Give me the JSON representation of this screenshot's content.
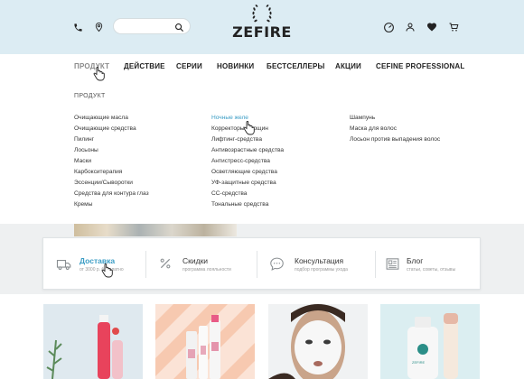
{
  "brand": {
    "name": "ZEFIRE"
  },
  "header": {
    "search": {
      "placeholder": ""
    }
  },
  "nav": {
    "items": [
      {
        "label": "ПРОДУКТ"
      },
      {
        "label": "ДЕЙСТВИЕ"
      },
      {
        "label": "СЕРИИ"
      },
      {
        "label": "НОВИНКИ"
      },
      {
        "label": "БЕСТСЕЛЛЕРЫ"
      },
      {
        "label": "АКЦИИ"
      },
      {
        "label": "CEFINE PROFESSIONAL"
      }
    ]
  },
  "dropdown": {
    "title": "ПРОДУКТ",
    "col1": [
      "Очищающие масла",
      "Очищающие средства",
      "Пилинг",
      "Лосьоны",
      "Маски",
      "Карбокситерапия",
      "Эссенции/Сыворотки",
      "Средства для контура глаз",
      "Кремы"
    ],
    "col2": [
      "Ночные желе",
      "Корректоры морщин",
      "Лифтинг-средства",
      "Антивозрастные средства",
      "Антистресс-средства",
      "Осветляющие средства",
      "УФ-защитные средства",
      "CC-средства",
      "Тональные средства"
    ],
    "col3": [
      "Шампунь",
      "Маска для волос",
      "Лосьон против выпадения волос"
    ]
  },
  "info": [
    {
      "title": "Доставка",
      "subtitle": "от 3000 р. бесплатно"
    },
    {
      "title": "Скидки",
      "subtitle": "программа лояльности"
    },
    {
      "title": "Консультация",
      "subtitle": "подбор программы ухода"
    },
    {
      "title": "Блог",
      "subtitle": "статьи, советы, отзывы"
    }
  ],
  "products": {
    "p4_label": "ZEFIRE"
  },
  "colors": {
    "header_bg": "#dcecf3",
    "accent": "#3b9dc5"
  }
}
